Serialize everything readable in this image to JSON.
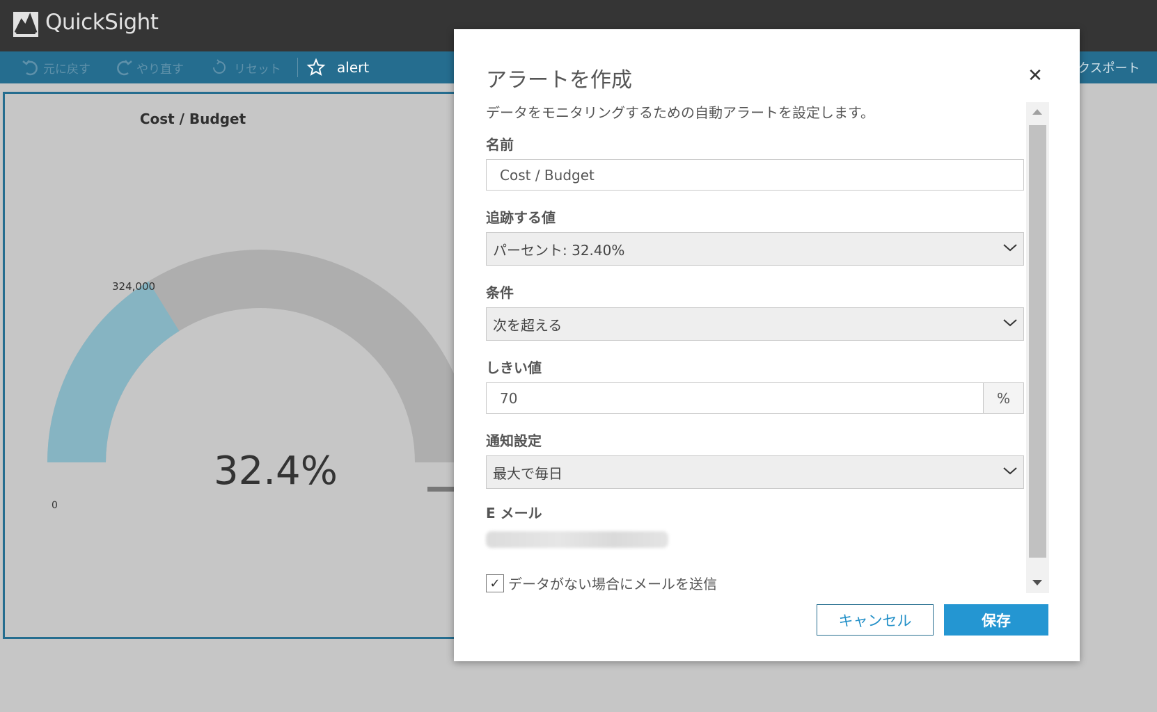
{
  "app": {
    "title": "QuickSight"
  },
  "toolbar": {
    "undo_label": "元に戻す",
    "redo_label": "やり直す",
    "reset_label": "リセット",
    "analysis_name": "alert",
    "export_label": "クスポート"
  },
  "visual": {
    "title": "Cost / Budget",
    "gauge_value": "32.4%",
    "gauge_max_label": "324,000",
    "gauge_min_label": "0",
    "gauge_fraction": 0.324,
    "colors": {
      "filled": "#86b4c2",
      "track": "#aeaeae",
      "needle": "#777777"
    }
  },
  "modal": {
    "title": "アラートを作成",
    "description": "データをモニタリングするための自動アラートを設定します。",
    "name_label": "名前",
    "name_value": "Cost  / Budget",
    "tracked_value_label": "追跡する値",
    "tracked_value": "パーセント: 32.40%",
    "condition_label": "条件",
    "condition_value": "次を超える",
    "threshold_label": "しきい値",
    "threshold_value": "70",
    "threshold_unit": "%",
    "notification_label": "通知設定",
    "notification_value": "最大で毎日",
    "email_label": "E メール",
    "no_data_checkbox_label": "データがない場合にメールを送信",
    "no_data_checked": true,
    "cancel_label": "キャンセル",
    "save_label": "保存",
    "colors": {
      "primary": "#2496d2",
      "toolbar": "#256d8f"
    }
  }
}
